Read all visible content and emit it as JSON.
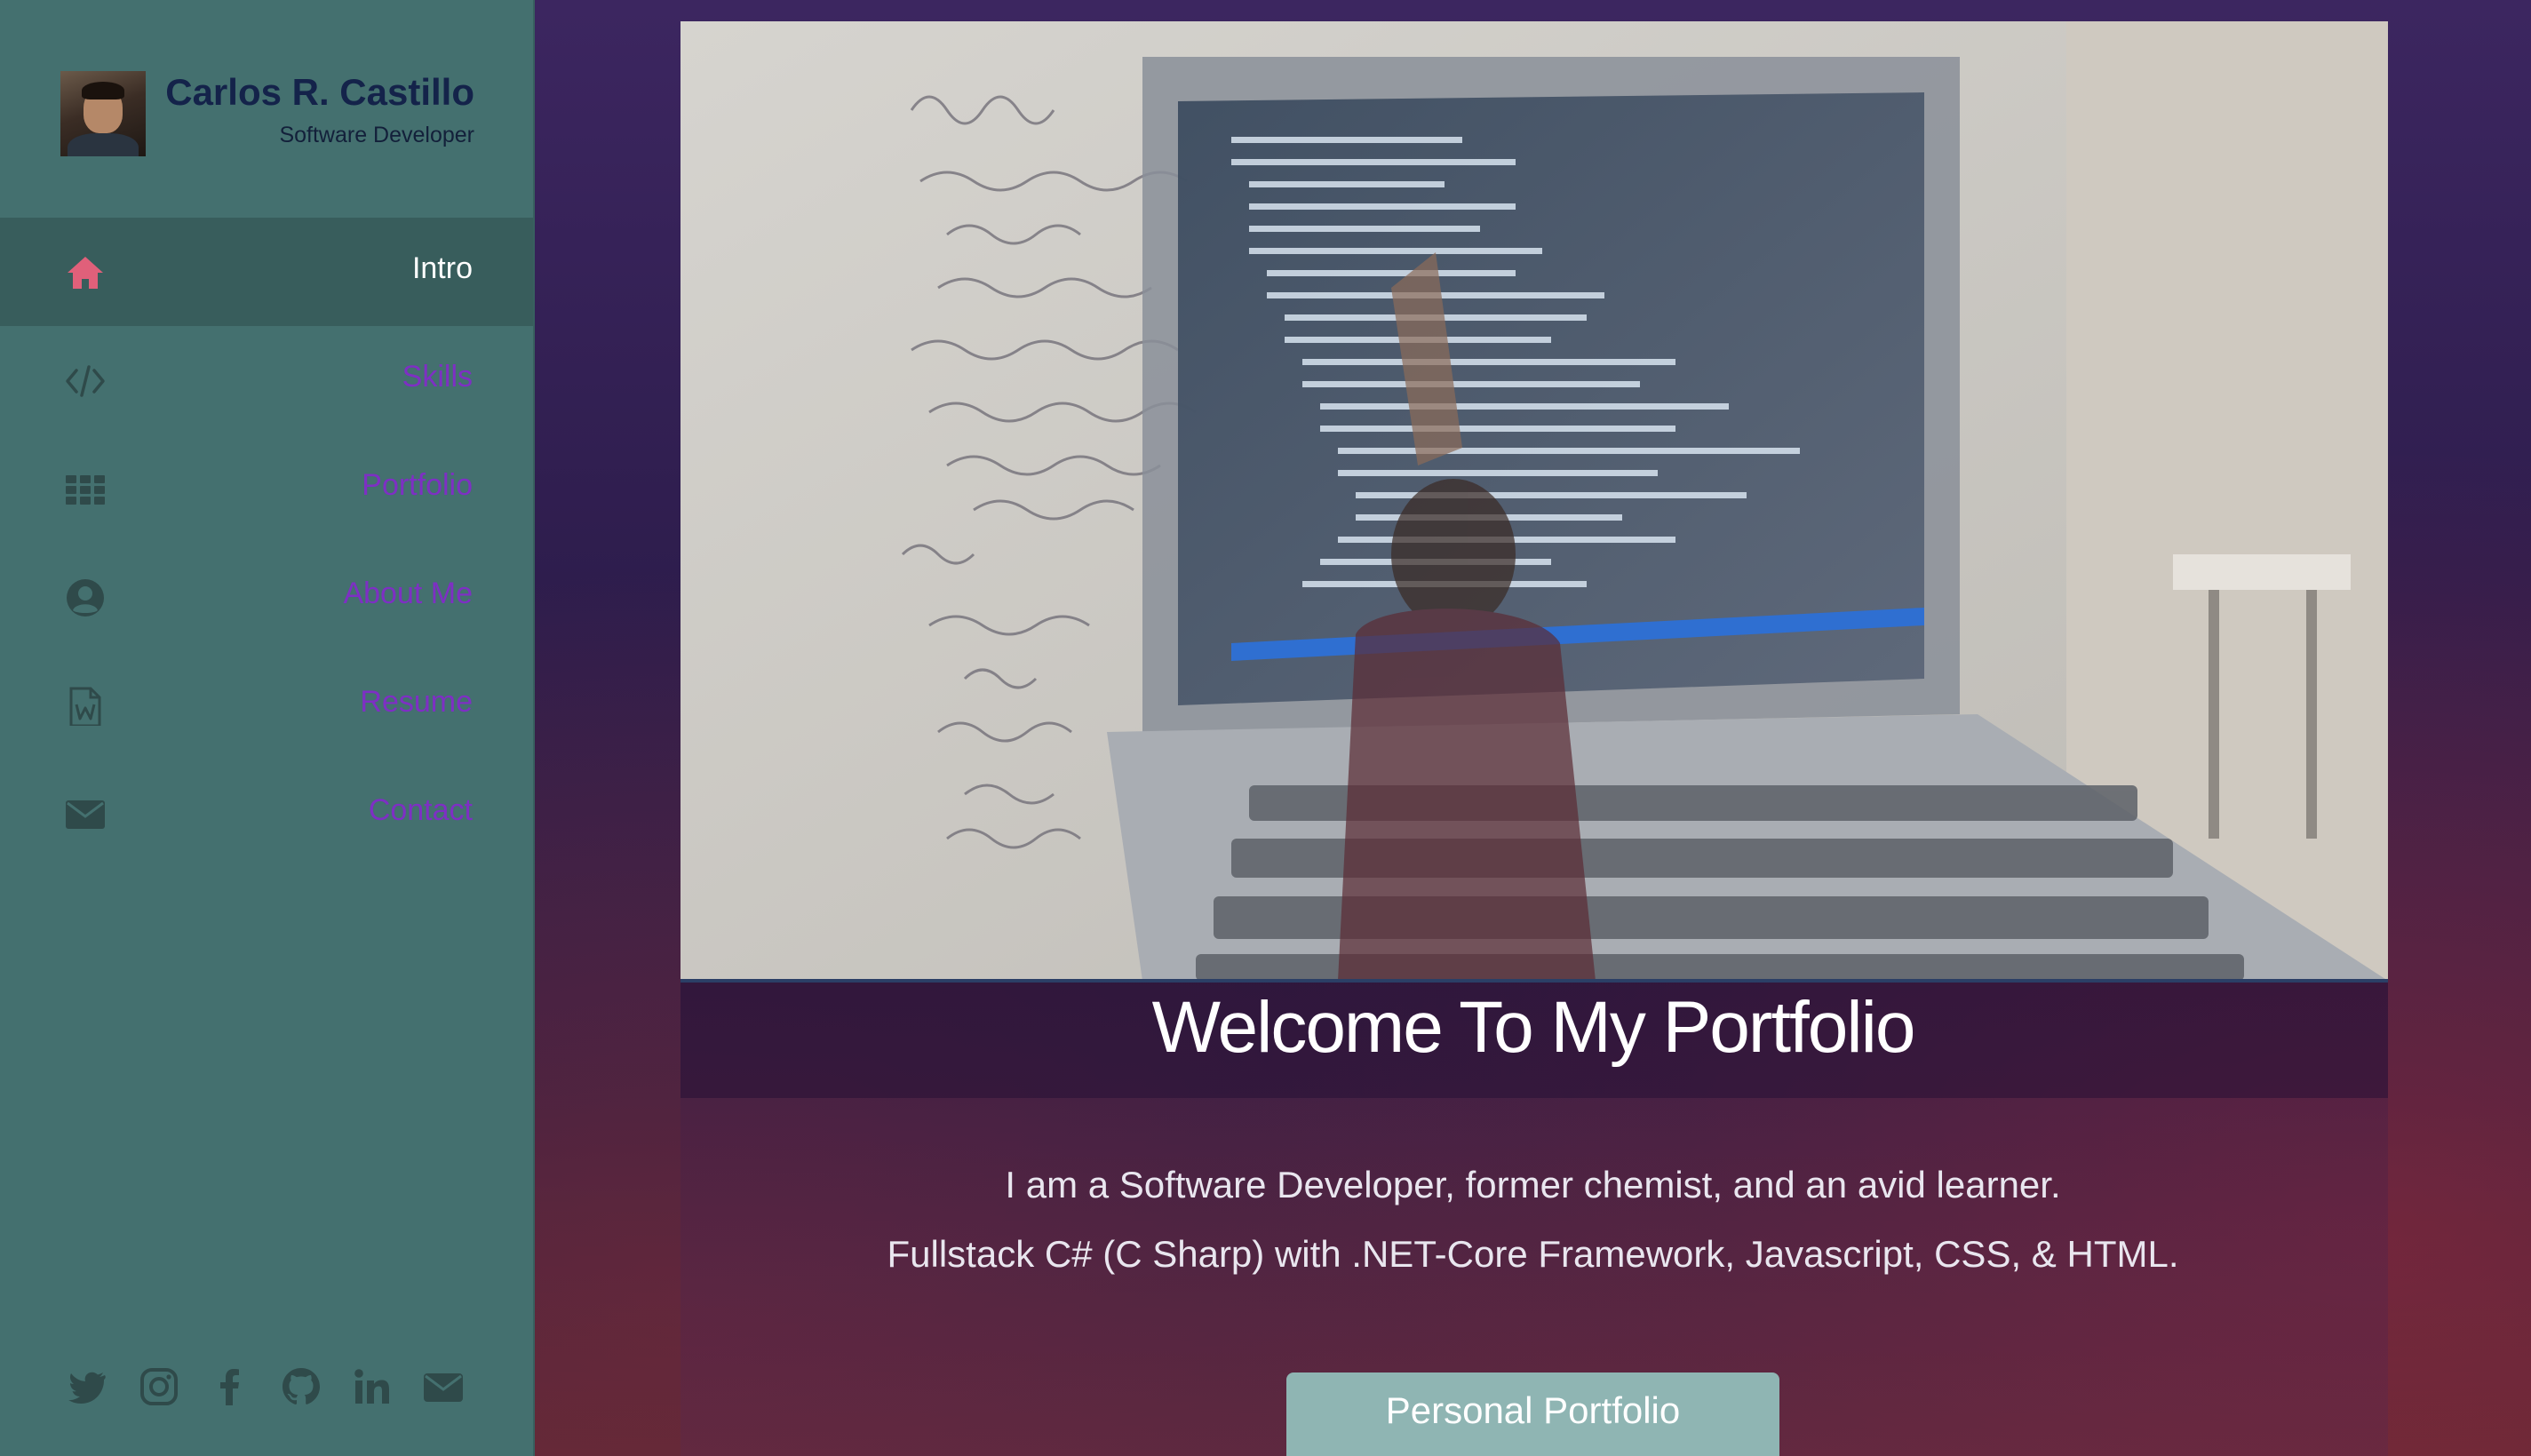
{
  "profile": {
    "name": "Carlos R. Castillo",
    "role": "Software Developer"
  },
  "nav": {
    "items": [
      {
        "label": "Intro",
        "icon": "home-icon",
        "active": true
      },
      {
        "label": "Skills",
        "icon": "code-icon",
        "active": false
      },
      {
        "label": "Portfolio",
        "icon": "grid-icon",
        "active": false
      },
      {
        "label": "About Me",
        "icon": "user-circle-icon",
        "active": false
      },
      {
        "label": "Resume",
        "icon": "word-document-icon",
        "active": false
      },
      {
        "label": "Contact",
        "icon": "envelope-icon",
        "active": false
      }
    ]
  },
  "social": [
    "twitter-icon",
    "instagram-icon",
    "facebook-icon",
    "github-icon",
    "linkedin-icon",
    "email-icon"
  ],
  "main": {
    "welcome": "Welcome To My Portfolio",
    "tagline_1": "I am a Software Developer, former chemist, and an avid learner.",
    "tagline_2": "Fullstack C# (C Sharp) with .NET-Core Framework, Javascript, CSS, & HTML.",
    "cta_label": "Personal Portfolio"
  },
  "colors": {
    "sidebar_bg": "#44706f",
    "sidebar_active": "#385d5c",
    "nav_link": "#7e2fc4",
    "home_icon": "#e0607a",
    "cta_bg": "#8fb5b3"
  }
}
